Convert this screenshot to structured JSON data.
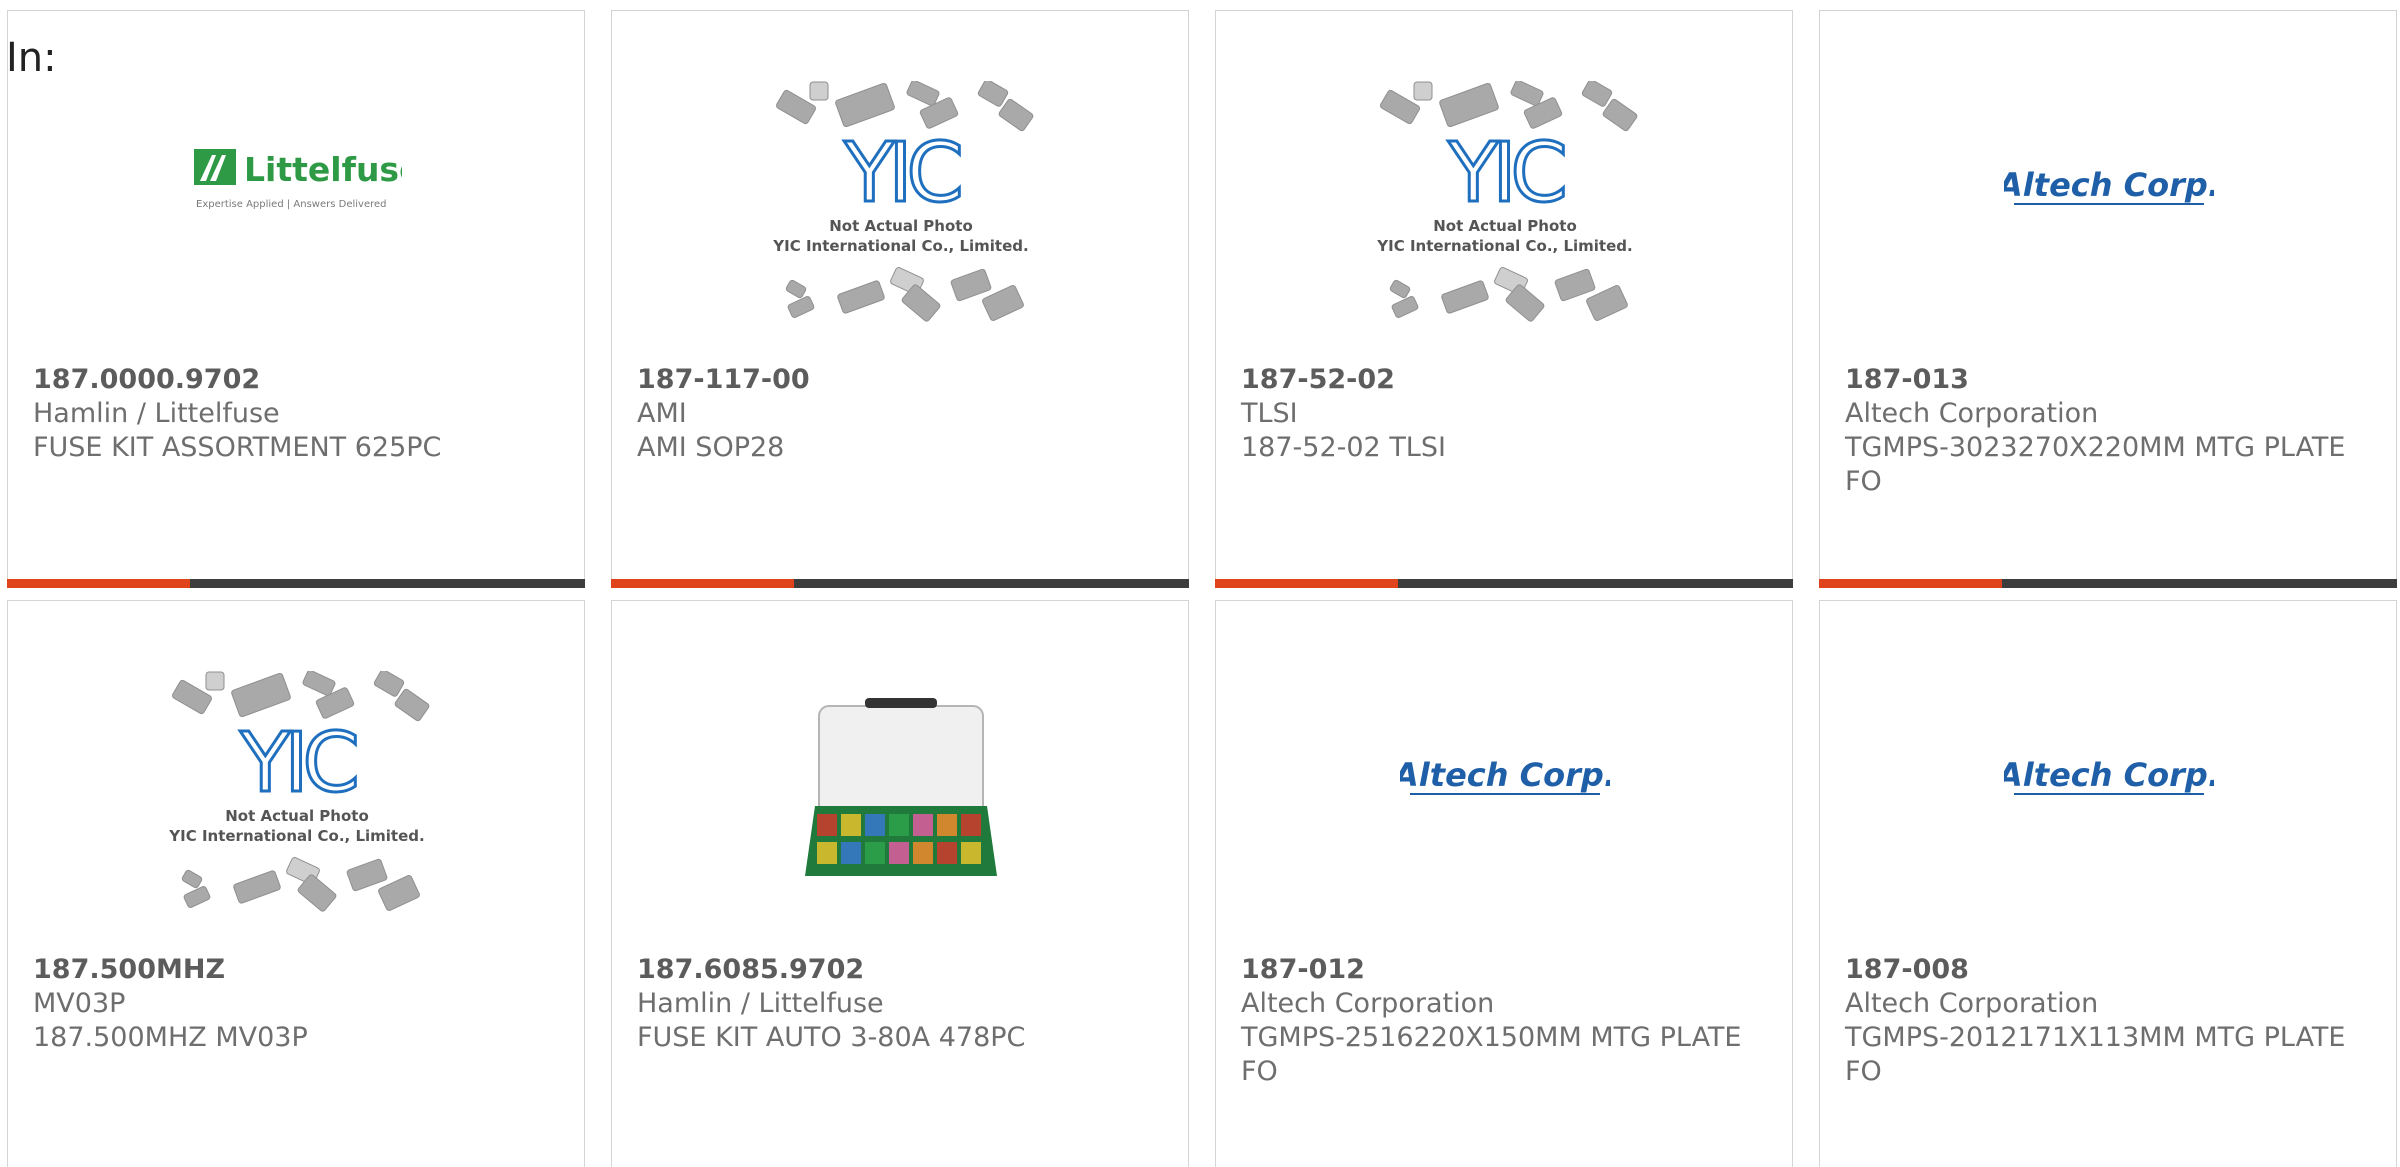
{
  "header": {
    "label": "In:"
  },
  "colors": {
    "accent": "#e0441c",
    "bar": "#3d3d3d",
    "border": "#d4d4d4",
    "text": "#6e6e6e"
  },
  "products": [
    {
      "part_number": "187.0000.9702",
      "manufacturer": "Hamlin / Littelfuse",
      "description": "FUSE KIT ASSORTMENT 625PC",
      "image": "littelfuse-logo",
      "logo_text": "Littelfuse",
      "logo_tagline": "Expertise Applied | Answers Delivered"
    },
    {
      "part_number": "187-117-00",
      "manufacturer": "AMI",
      "description": "AMI SOP28",
      "image": "yic-placeholder",
      "logo_text": "YIC",
      "caption_1": "Not Actual Photo",
      "caption_2": "YIC International Co., Limited."
    },
    {
      "part_number": "187-52-02",
      "manufacturer": "TLSI",
      "description": "187-52-02 TLSI",
      "image": "yic-placeholder",
      "logo_text": "YIC",
      "caption_1": "Not Actual Photo",
      "caption_2": "YIC International Co., Limited."
    },
    {
      "part_number": "187-013",
      "manufacturer": "Altech Corporation",
      "description": "TGMPS-3023270X220MM MTG PLATE FO",
      "image": "altech-logo",
      "logo_text": "Altech Corp."
    },
    {
      "part_number": "187.500MHZ",
      "manufacturer": "MV03P",
      "description": "187.500MHZ MV03P",
      "image": "yic-placeholder",
      "logo_text": "YIC",
      "caption_1": "Not Actual Photo",
      "caption_2": "YIC International Co., Limited."
    },
    {
      "part_number": "187.6085.9702",
      "manufacturer": "Hamlin / Littelfuse",
      "description": "FUSE KIT AUTO 3-80A 478PC",
      "image": "fuse-kit-box-photo"
    },
    {
      "part_number": "187-012",
      "manufacturer": "Altech Corporation",
      "description": "TGMPS-2516220X150MM MTG PLATE FO",
      "image": "altech-logo",
      "logo_text": "Altech Corp."
    },
    {
      "part_number": "187-008",
      "manufacturer": "Altech Corporation",
      "description": "TGMPS-2012171X113MM MTG PLATE FO",
      "image": "altech-logo",
      "logo_text": "Altech Corp."
    }
  ]
}
